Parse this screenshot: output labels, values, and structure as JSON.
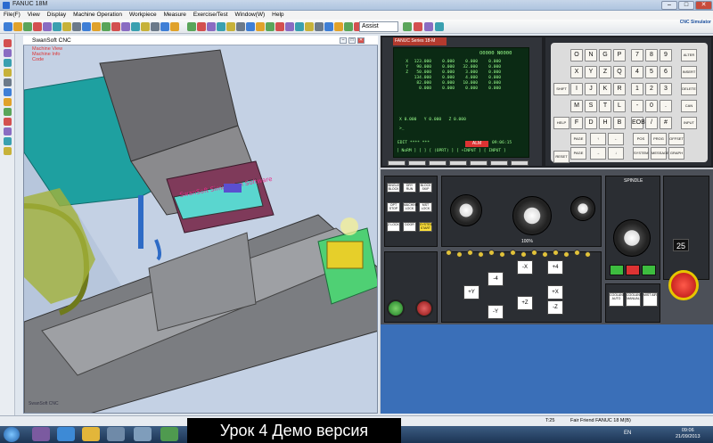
{
  "window": {
    "title": "FANUC 18M"
  },
  "menu": [
    "File(F)",
    "View",
    "Display",
    "Machine Operation",
    "Workpiece",
    "Measure",
    "Exercise/Test",
    "Window(W)",
    "Help"
  ],
  "toolbar": {
    "mode": "Assist"
  },
  "brand_logo": "CNC Simulator",
  "viewport": {
    "title": "SwanSoft CNC",
    "tree": [
      "Machine View",
      "Machine Info",
      "Code"
    ],
    "corner_label": "SwanSoft CNC",
    "sign_text": "SwanSoft Simulation Software"
  },
  "cnc": {
    "header": "FANUC Series 18-M",
    "program": "O0000  N0000",
    "rows": [
      [
        "X",
        "123.000",
        "0.000",
        "0.000",
        "0.000"
      ],
      [
        "Y",
        "90.000",
        "0.000",
        "32.000",
        "0.000"
      ],
      [
        "Z",
        "50.000",
        "0.000",
        "3.000",
        "0.000"
      ],
      [
        "",
        "134.000",
        "0.000",
        "4.000",
        "0.000"
      ],
      [
        "",
        "82.000",
        "0.000",
        "10.000",
        "0.000"
      ],
      [
        "",
        "0.000",
        "0.000",
        "0.000",
        "0.000"
      ]
    ],
    "pos": [
      "X",
      "0.000",
      "Y",
      "0.000",
      "Z",
      "0.000"
    ],
    "prompt": ">_",
    "mode_line": "EDIT **** ***",
    "alarm": "ALM",
    "time": "09:06:15",
    "softkeys": [
      "[ NoRM ]",
      "[        ]",
      "[ (OPRT) ]",
      "[ +INPUT ]",
      "[ INPUT ]"
    ]
  },
  "keypad": {
    "rows": [
      [
        "O",
        "N",
        "G",
        "P",
        "7",
        "8",
        "9"
      ],
      [
        "X",
        "Y",
        "Z",
        "Q",
        "4",
        "5",
        "6"
      ],
      [
        "I",
        "J",
        "K",
        "R",
        "1",
        "2",
        "3"
      ],
      [
        "M",
        "S",
        "T",
        "L",
        "-",
        "0",
        "."
      ],
      [
        "F",
        "D",
        "H",
        "B",
        "EOB",
        "/",
        "#"
      ]
    ],
    "side_keys": [
      "ALTER",
      "INSERT",
      "DELETE",
      "CAN",
      "INPUT",
      "SHIFT",
      "HELP",
      "RESET"
    ],
    "func_keys": [
      "POS",
      "PROG",
      "OFFSET SETTING",
      "SYSTEM",
      "MESSAGE",
      "GRAPH"
    ],
    "page_keys": [
      "PAGE",
      "PAGE"
    ]
  },
  "operator": {
    "mode_keys": [
      "SINGLE BLOCK",
      "DRY RUN",
      "BLOCK SKIP",
      "OPT STOP",
      "MACHINE LOCK",
      "MST LOCK",
      "Z LOCK",
      "DOOR",
      "SYSTEM START"
    ],
    "jog_keys": [
      "-X",
      "+Y",
      "+Z",
      "+X",
      "-Y",
      "-Z",
      "+4",
      "-4"
    ],
    "coolant_keys": [
      "COOLANT AUTO",
      "COOLANT MANUAL",
      "MIST AIR"
    ],
    "display_value": "25",
    "spindle_label": "SPINDLE",
    "speed_label": "100%"
  },
  "status": {
    "text": "Fair Friend FANUC 18 M(B)",
    "time": "T:25"
  },
  "taskbar": {
    "lang": "EN",
    "clock_time": "09:06",
    "clock_date": "21/09/2013"
  },
  "overlay": {
    "text": "Урок 4 Демо версия"
  }
}
